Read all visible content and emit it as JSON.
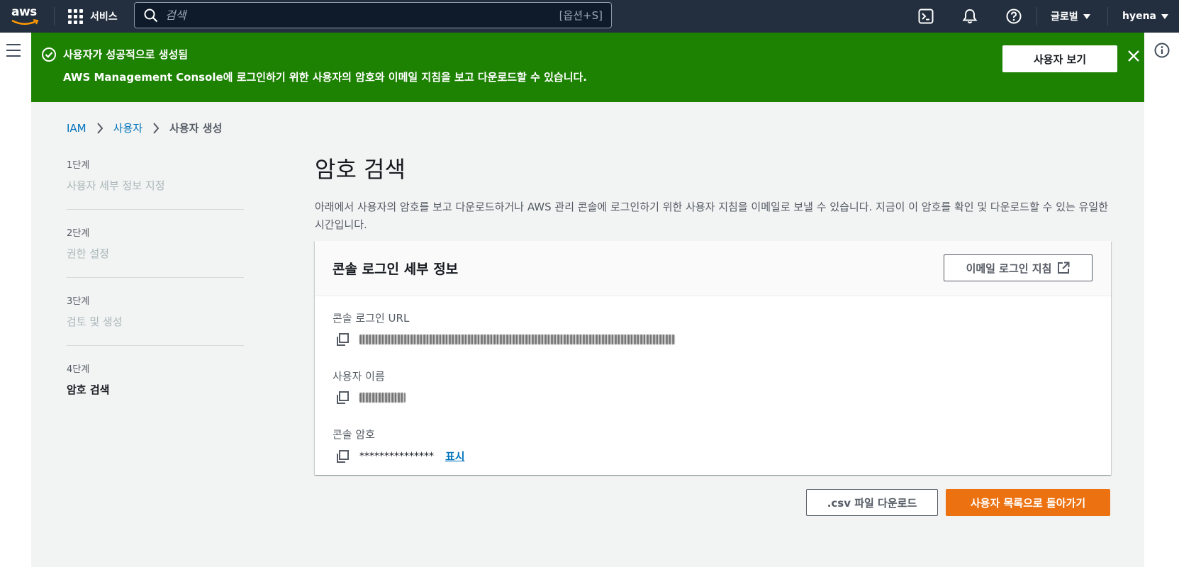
{
  "topnav": {
    "logo_text": "aws",
    "services_label": "서비스",
    "search_placeholder": "검색",
    "search_shortcut": "[옵션+S]",
    "region_label": "글로벌",
    "user_label": "hyena"
  },
  "flash": {
    "title": "사용자가 성공적으로 생성됨",
    "message": "AWS Management Console에 로그인하기 위한 사용자의 암호와 이메일 지침을 보고 다운로드할 수 있습니다.",
    "button_label": "사용자 보기",
    "color": "#1d8102"
  },
  "breadcrumb": {
    "items": [
      "IAM",
      "사용자"
    ],
    "current": "사용자 생성"
  },
  "steps": [
    {
      "number": "1단계",
      "label": "사용자 세부 정보 지정"
    },
    {
      "number": "2단계",
      "label": "권한 설정"
    },
    {
      "number": "3단계",
      "label": "검토 및 생성"
    },
    {
      "number": "4단계",
      "label": "암호 검색"
    }
  ],
  "page": {
    "title": "암호 검색",
    "description": "아래에서 사용자의 암호를 보고 다운로드하거나 AWS 관리 콘솔에 로그인하기 위한 사용자 지침을 이메일로 보낼 수 있습니다. 지금이 이 암호를 확인 및 다운로드할 수 있는 유일한 시간입니다."
  },
  "panel": {
    "title": "콘솔 로그인 세부 정보",
    "email_button": "이메일 로그인 지침",
    "fields": [
      {
        "label": "콘솔 로그인 URL"
      },
      {
        "label": "사용자 이름"
      },
      {
        "label": "콘솔 암호",
        "value": "***************",
        "action": "표시"
      }
    ]
  },
  "actions": {
    "csv_download": ".csv 파일 다운로드",
    "return_to_users": "사용자 목록으로 돌아가기",
    "primary_color": "#ec7211"
  },
  "icons": [
    "grid-icon",
    "search-icon",
    "cloudshell-icon",
    "bell-icon",
    "help-icon",
    "hamburger-icon",
    "info-icon",
    "check-circle-icon",
    "close-icon",
    "external-link-icon",
    "copy-icon"
  ]
}
